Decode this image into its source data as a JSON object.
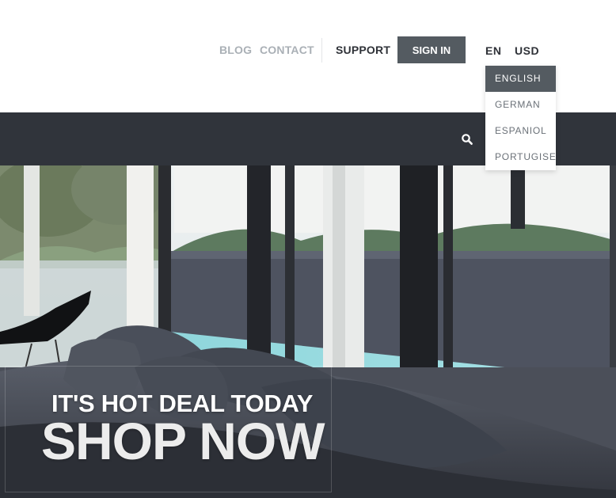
{
  "header": {
    "links": [
      {
        "label": "BLOG"
      },
      {
        "label": "CONTACT"
      },
      {
        "label": "SUPPORT"
      }
    ],
    "signin_label": "SIGN IN",
    "language_code": "EN",
    "currency": "USD"
  },
  "language_menu": {
    "items": [
      {
        "label": "ENGLISH",
        "active": true
      },
      {
        "label": "GERMAN"
      },
      {
        "label": "ESPANIOL"
      },
      {
        "label": "PORTUGISE"
      }
    ]
  },
  "navbar": {
    "search_icon": "search-icon",
    "background": "#30343b"
  },
  "hero": {
    "subtitle": "IT'S HOT DEAL TODAY",
    "title": "SHOP NOW"
  },
  "colors": {
    "accent": "#545b61",
    "muted_link": "#aab0b6",
    "dark_text": "#2f3238"
  }
}
